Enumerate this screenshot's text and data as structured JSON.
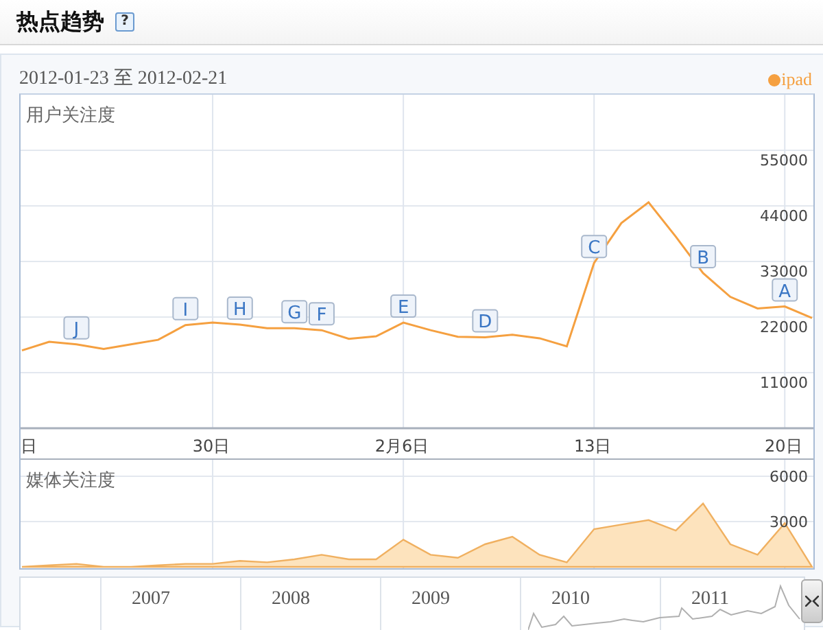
{
  "header": {
    "title": "热点趋势",
    "help": "?"
  },
  "date_range": "2012-01-23 至 2012-02-21",
  "user_chart": {
    "title": "用户关注度",
    "chart_data": {
      "type": "line",
      "x": [
        "2012-01-23",
        "2012-01-24",
        "2012-01-25",
        "2012-01-26",
        "2012-01-27",
        "2012-01-28",
        "2012-01-29",
        "2012-01-30",
        "2012-01-31",
        "2012-02-01",
        "2012-02-02",
        "2012-02-03",
        "2012-02-04",
        "2012-02-05",
        "2012-02-06",
        "2012-02-07",
        "2012-02-08",
        "2012-02-09",
        "2012-02-10",
        "2012-02-11",
        "2012-02-12",
        "2012-02-13",
        "2012-02-14",
        "2012-02-15",
        "2012-02-16",
        "2012-02-17",
        "2012-02-18",
        "2012-02-19",
        "2012-02-20",
        "2012-02-21"
      ],
      "xlim": [
        "2012-01-23",
        "2012-02-21"
      ],
      "xticks": [
        {
          "value": "2012-01-23",
          "label": "日"
        },
        {
          "value": "2012-01-30",
          "label": "30日"
        },
        {
          "value": "2012-02-06",
          "label": "2月6日"
        },
        {
          "value": "2012-02-13",
          "label": "13日"
        },
        {
          "value": "2012-02-20",
          "label": "20日"
        }
      ],
      "series": [
        {
          "name": "ipad",
          "color": "#f5a040",
          "values": [
            15400,
            17100,
            16600,
            15700,
            16600,
            17500,
            20400,
            20900,
            20500,
            19800,
            19800,
            19400,
            17700,
            18200,
            20900,
            19400,
            18100,
            18000,
            18500,
            17800,
            16200,
            32700,
            40600,
            44700,
            37900,
            30700,
            26000,
            23700,
            24100,
            21800
          ]
        }
      ],
      "ylim": [
        0,
        66000
      ],
      "yticks": [
        {
          "value": 11000,
          "label": "11000"
        },
        {
          "value": 22000,
          "label": "22000"
        },
        {
          "value": 33000,
          "label": "33000"
        },
        {
          "value": 44000,
          "label": "44000"
        },
        {
          "value": 55000,
          "label": "55000"
        }
      ],
      "grid": true,
      "annotations": [
        {
          "x": "2012-01-25",
          "text": "J"
        },
        {
          "x": "2012-01-29",
          "text": "I"
        },
        {
          "x": "2012-01-31",
          "text": "H"
        },
        {
          "x": "2012-02-02",
          "text": "G"
        },
        {
          "x": "2012-02-03",
          "text": "F"
        },
        {
          "x": "2012-02-06",
          "text": "E"
        },
        {
          "x": "2012-02-09",
          "text": "D"
        },
        {
          "x": "2012-02-13",
          "text": "C"
        },
        {
          "x": "2012-02-17",
          "text": "B"
        },
        {
          "x": "2012-02-20",
          "text": "A"
        }
      ]
    }
  },
  "media_chart": {
    "title": "媒体关注度",
    "chart_data": {
      "type": "area",
      "series": [
        {
          "color": "#f0b060",
          "values": [
            0,
            100,
            200,
            0,
            0,
            100,
            200,
            200,
            400,
            300,
            500,
            800,
            500,
            500,
            1800,
            800,
            600,
            1500,
            2000,
            800,
            300,
            2500,
            2800,
            3100,
            2400,
            4200,
            1500,
            800,
            2900,
            0
          ]
        }
      ],
      "ylim": [
        0,
        7000
      ],
      "yticks": [
        {
          "value": 3000,
          "label": "3000"
        },
        {
          "value": 6000,
          "label": "6000"
        }
      ],
      "grid": true
    }
  },
  "navigator": {
    "years": [
      "2007",
      "2008",
      "2009",
      "2010",
      "2011"
    ]
  }
}
